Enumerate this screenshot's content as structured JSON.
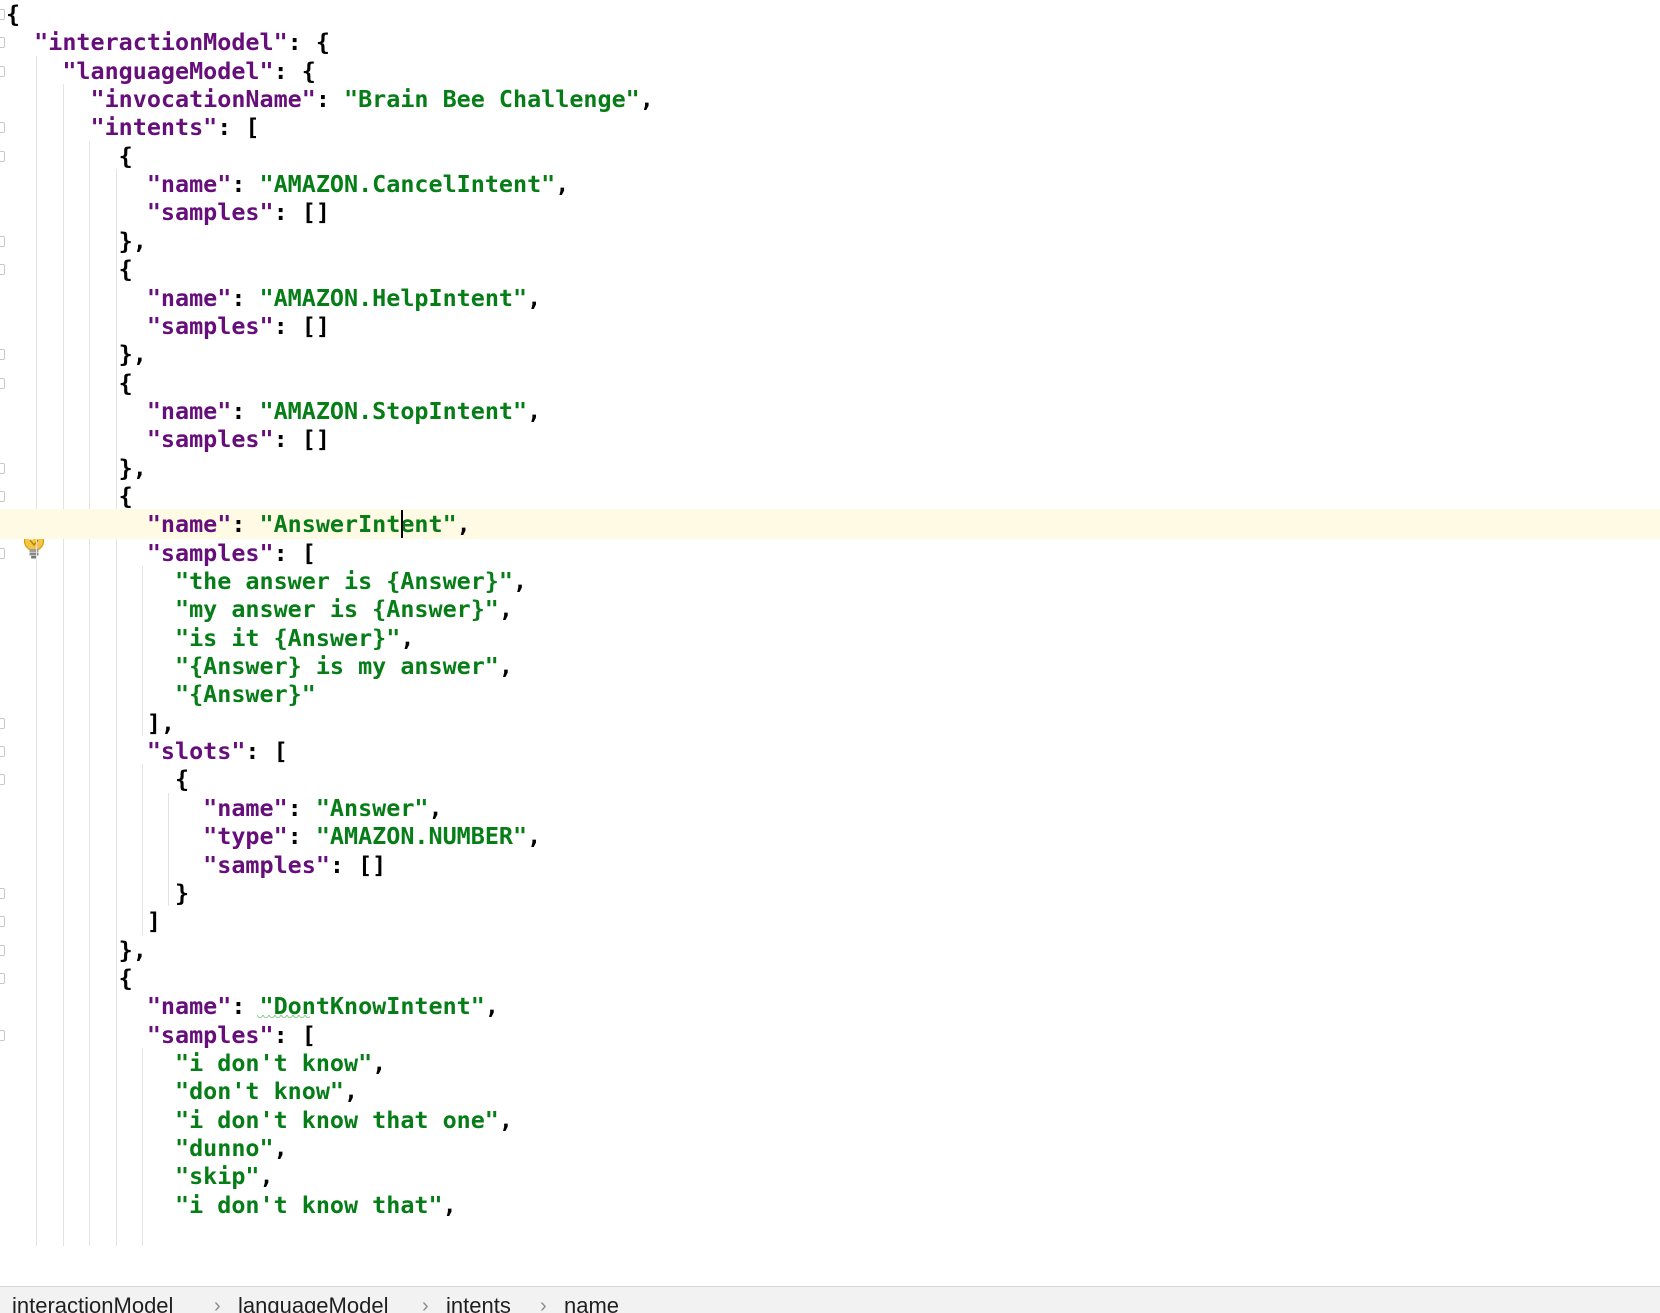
{
  "editor": {
    "language": "json",
    "caret_line": 19,
    "lines": [
      [
        [
          "p",
          "{"
        ]
      ],
      [
        [
          "p",
          "  "
        ],
        [
          "k",
          "\"interactionModel\""
        ],
        [
          "p",
          ": {"
        ]
      ],
      [
        [
          "p",
          "    "
        ],
        [
          "k",
          "\"languageModel\""
        ],
        [
          "p",
          ": {"
        ]
      ],
      [
        [
          "p",
          "      "
        ],
        [
          "k",
          "\"invocationName\""
        ],
        [
          "p",
          ": "
        ],
        [
          "s",
          "\"Brain Bee Challenge\""
        ],
        [
          "p",
          ","
        ]
      ],
      [
        [
          "p",
          "      "
        ],
        [
          "k",
          "\"intents\""
        ],
        [
          "p",
          ": ["
        ]
      ],
      [
        [
          "p",
          "        {"
        ]
      ],
      [
        [
          "p",
          "          "
        ],
        [
          "k",
          "\"name\""
        ],
        [
          "p",
          ": "
        ],
        [
          "s",
          "\"AMAZON.CancelIntent\""
        ],
        [
          "p",
          ","
        ]
      ],
      [
        [
          "p",
          "          "
        ],
        [
          "k",
          "\"samples\""
        ],
        [
          "p",
          ": []"
        ]
      ],
      [
        [
          "p",
          "        },"
        ]
      ],
      [
        [
          "p",
          "        {"
        ]
      ],
      [
        [
          "p",
          "          "
        ],
        [
          "k",
          "\"name\""
        ],
        [
          "p",
          ": "
        ],
        [
          "s",
          "\"AMAZON.HelpIntent\""
        ],
        [
          "p",
          ","
        ]
      ],
      [
        [
          "p",
          "          "
        ],
        [
          "k",
          "\"samples\""
        ],
        [
          "p",
          ": []"
        ]
      ],
      [
        [
          "p",
          "        },"
        ]
      ],
      [
        [
          "p",
          "        {"
        ]
      ],
      [
        [
          "p",
          "          "
        ],
        [
          "k",
          "\"name\""
        ],
        [
          "p",
          ": "
        ],
        [
          "s",
          "\"AMAZON.StopIntent\""
        ],
        [
          "p",
          ","
        ]
      ],
      [
        [
          "p",
          "          "
        ],
        [
          "k",
          "\"samples\""
        ],
        [
          "p",
          ": []"
        ]
      ],
      [
        [
          "p",
          "        },"
        ]
      ],
      [
        [
          "p",
          "        {"
        ]
      ],
      [
        [
          "p",
          "          "
        ],
        [
          "k",
          "\"name\""
        ],
        [
          "p",
          ": "
        ],
        [
          "s",
          "\"AnswerIntent\""
        ],
        [
          "p",
          ","
        ]
      ],
      [
        [
          "p",
          "          "
        ],
        [
          "k",
          "\"samples\""
        ],
        [
          "p",
          ": ["
        ]
      ],
      [
        [
          "p",
          "            "
        ],
        [
          "s",
          "\"the answer is {Answer}\""
        ],
        [
          "p",
          ","
        ]
      ],
      [
        [
          "p",
          "            "
        ],
        [
          "s",
          "\"my answer is {Answer}\""
        ],
        [
          "p",
          ","
        ]
      ],
      [
        [
          "p",
          "            "
        ],
        [
          "s",
          "\"is it {Answer}\""
        ],
        [
          "p",
          ","
        ]
      ],
      [
        [
          "p",
          "            "
        ],
        [
          "s",
          "\"{Answer} is my answer\""
        ],
        [
          "p",
          ","
        ]
      ],
      [
        [
          "p",
          "            "
        ],
        [
          "s",
          "\"{Answer}\""
        ]
      ],
      [
        [
          "p",
          "          ],"
        ]
      ],
      [
        [
          "p",
          "          "
        ],
        [
          "k",
          "\"slots\""
        ],
        [
          "p",
          ": ["
        ]
      ],
      [
        [
          "p",
          "            {"
        ]
      ],
      [
        [
          "p",
          "              "
        ],
        [
          "k",
          "\"name\""
        ],
        [
          "p",
          ": "
        ],
        [
          "s",
          "\"Answer\""
        ],
        [
          "p",
          ","
        ]
      ],
      [
        [
          "p",
          "              "
        ],
        [
          "k",
          "\"type\""
        ],
        [
          "p",
          ": "
        ],
        [
          "s",
          "\"AMAZON.NUMBER\""
        ],
        [
          "p",
          ","
        ]
      ],
      [
        [
          "p",
          "              "
        ],
        [
          "k",
          "\"samples\""
        ],
        [
          "p",
          ": []"
        ]
      ],
      [
        [
          "p",
          "            }"
        ]
      ],
      [
        [
          "p",
          "          ]"
        ]
      ],
      [
        [
          "p",
          "        },"
        ]
      ],
      [
        [
          "p",
          "        {"
        ]
      ],
      [
        [
          "p",
          "          "
        ],
        [
          "k",
          "\"name\""
        ],
        [
          "p",
          ": "
        ],
        [
          "s",
          "\"DontKnowIntent\""
        ],
        [
          "p",
          ","
        ]
      ],
      [
        [
          "p",
          "          "
        ],
        [
          "k",
          "\"samples\""
        ],
        [
          "p",
          ": ["
        ]
      ],
      [
        [
          "p",
          "            "
        ],
        [
          "s",
          "\"i don't know\""
        ],
        [
          "p",
          ","
        ]
      ],
      [
        [
          "p",
          "            "
        ],
        [
          "s",
          "\"don't know\""
        ],
        [
          "p",
          ","
        ]
      ],
      [
        [
          "p",
          "            "
        ],
        [
          "s",
          "\"i don't know that one\""
        ],
        [
          "p",
          ","
        ]
      ],
      [
        [
          "p",
          "            "
        ],
        [
          "s",
          "\"dunno\""
        ],
        [
          "p",
          ","
        ]
      ],
      [
        [
          "p",
          "            "
        ],
        [
          "s",
          "\"skip\""
        ],
        [
          "p",
          ","
        ]
      ],
      [
        [
          "p",
          "            "
        ],
        [
          "s",
          "\"i don't know that\""
        ],
        [
          "p",
          ","
        ]
      ]
    ]
  },
  "gutter": {
    "intention_icon": "lightbulb-icon"
  },
  "breadcrumb": {
    "items": [
      "interactionModel",
      "languageModel",
      "intents",
      "name"
    ],
    "separator": "›"
  },
  "colors": {
    "key": "#660e7a",
    "string": "#067d17",
    "punctuation": "#000000",
    "current_line": "#fffae3",
    "background": "#ffffff"
  }
}
